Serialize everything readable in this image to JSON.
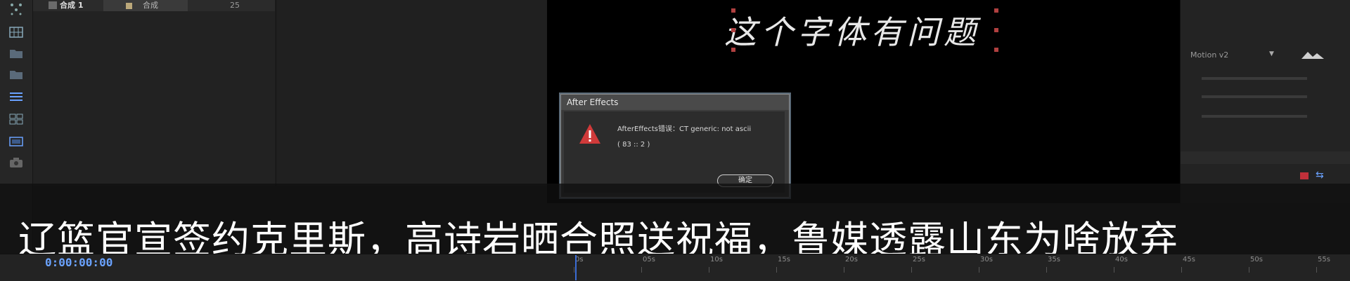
{
  "project": {
    "item_name": "合成 1",
    "item_type": "合成",
    "item_value": "25"
  },
  "viewer": {
    "text": "这个字体有问题"
  },
  "right_panel": {
    "preset": "Motion v2"
  },
  "dialog": {
    "title": "After Effects",
    "message": "AfterEffects错误：CT generic: not ascii",
    "code": "( 83 :: 2 )",
    "ok_label": "确定"
  },
  "subtitle": "辽篮官宣签约克里斯，高诗岩晒合照送祝福，鲁媒透露山东为啥放弃",
  "timeline": {
    "timecode": "0:00:00:00",
    "ruler_labels": [
      "0s",
      "05s",
      "10s",
      "15s",
      "20s",
      "25s",
      "30s",
      "35s",
      "40s",
      "45s",
      "50s",
      "55s"
    ]
  },
  "tools": [
    "puppet-icon",
    "grid-icon",
    "folder-icon",
    "folder-icon",
    "list-icon",
    "layout-icon",
    "layer-icon",
    "camera-icon"
  ],
  "colors": {
    "accent_blue": "#6aa2ff",
    "warning_red": "#d03a3a",
    "playhead": "#3b6cd4"
  }
}
